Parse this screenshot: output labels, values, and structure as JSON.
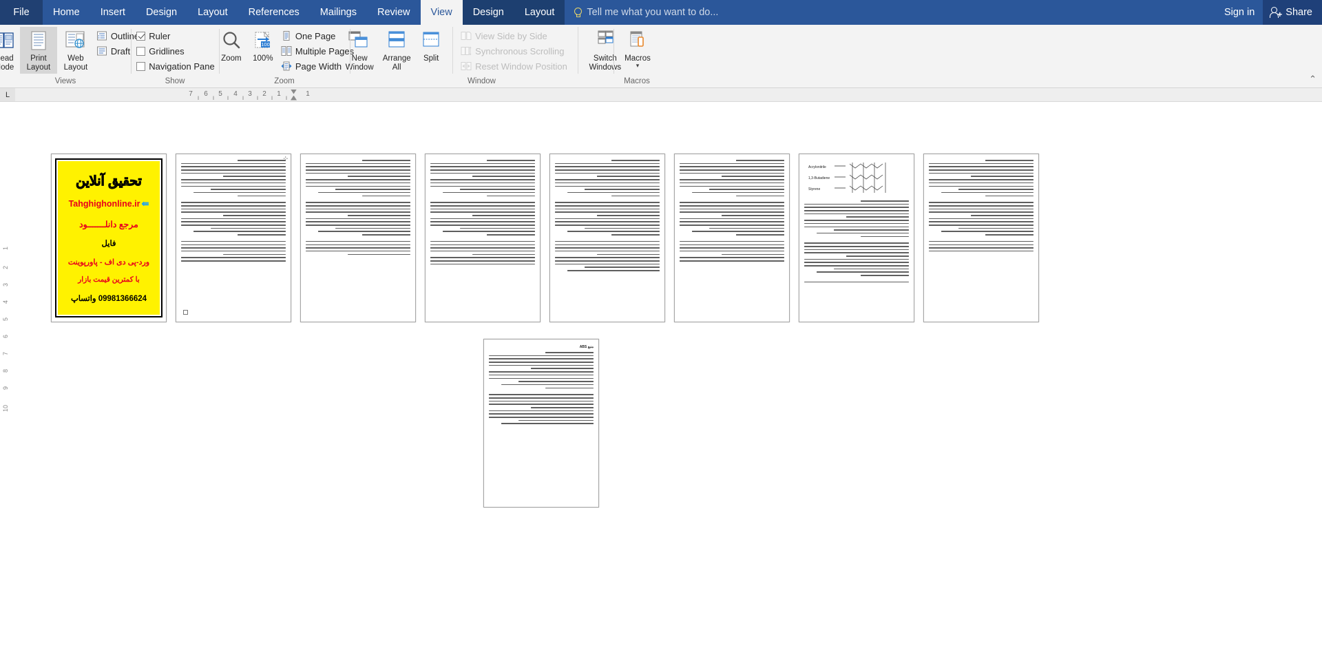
{
  "app": {
    "name": "Microsoft Word",
    "file_tab": "File"
  },
  "tabs": [
    {
      "label": "Home",
      "active": false,
      "contextual": false
    },
    {
      "label": "Insert",
      "active": false,
      "contextual": false
    },
    {
      "label": "Design",
      "active": false,
      "contextual": false
    },
    {
      "label": "Layout",
      "active": false,
      "contextual": false
    },
    {
      "label": "References",
      "active": false,
      "contextual": false
    },
    {
      "label": "Mailings",
      "active": false,
      "contextual": false
    },
    {
      "label": "Review",
      "active": false,
      "contextual": false
    },
    {
      "label": "View",
      "active": true,
      "contextual": false
    },
    {
      "label": "Design",
      "active": false,
      "contextual": true
    },
    {
      "label": "Layout",
      "active": false,
      "contextual": true
    }
  ],
  "tellme": {
    "placeholder": "Tell me what you want to do...",
    "icon": "lightbulb-icon"
  },
  "account": {
    "sign_in": "Sign in",
    "share": "Share",
    "share_icon": "person-add-icon"
  },
  "ribbon": {
    "collapse_icon": "chevron-up-icon",
    "groups": [
      {
        "name": "views",
        "label": "Views",
        "big_buttons": [
          {
            "label": "Read\nMode",
            "icon": "read-mode-icon",
            "selected": false
          },
          {
            "label": "Print\nLayout",
            "icon": "print-layout-icon",
            "selected": true
          },
          {
            "label": "Web\nLayout",
            "icon": "web-layout-icon",
            "selected": false
          }
        ],
        "small_items": [
          {
            "label": "Outline",
            "icon": "outline-icon"
          },
          {
            "label": "Draft",
            "icon": "draft-icon"
          }
        ]
      },
      {
        "name": "show",
        "label": "Show",
        "checkboxes": [
          {
            "label": "Ruler",
            "checked": true
          },
          {
            "label": "Gridlines",
            "checked": false
          },
          {
            "label": "Navigation Pane",
            "checked": false
          }
        ]
      },
      {
        "name": "zoom",
        "label": "Zoom",
        "big_buttons": [
          {
            "label": "Zoom",
            "icon": "magnifier-icon",
            "selected": false
          },
          {
            "label": "100%",
            "icon": "zoom-100-icon",
            "selected": false
          }
        ],
        "small_items": [
          {
            "label": "One Page",
            "icon": "one-page-icon"
          },
          {
            "label": "Multiple Pages",
            "icon": "multiple-pages-icon"
          },
          {
            "label": "Page Width",
            "icon": "page-width-icon"
          }
        ]
      },
      {
        "name": "window",
        "label": "Window",
        "big_buttons": [
          {
            "label": "New\nWindow",
            "icon": "new-window-icon",
            "selected": false
          },
          {
            "label": "Arrange\nAll",
            "icon": "arrange-all-icon",
            "selected": false
          },
          {
            "label": "Split",
            "icon": "split-icon",
            "selected": false
          }
        ],
        "small_items": [
          {
            "label": "View Side by Side",
            "icon": "side-by-side-icon",
            "disabled": true
          },
          {
            "label": "Synchronous Scrolling",
            "icon": "sync-scroll-icon",
            "disabled": true
          },
          {
            "label": "Reset Window Position",
            "icon": "reset-position-icon",
            "disabled": true
          }
        ],
        "big_buttons2": [
          {
            "label": "Switch\nWindows",
            "icon": "switch-windows-icon",
            "dropdown": true
          }
        ]
      },
      {
        "name": "macros",
        "label": "Macros",
        "big_buttons": [
          {
            "label": "Macros",
            "icon": "macros-icon",
            "dropdown": true
          }
        ]
      }
    ]
  },
  "ruler": {
    "tab_selector": "L",
    "numbers": [
      "7",
      "6",
      "5",
      "4",
      "3",
      "2",
      "1",
      "1"
    ],
    "direction": "rtl"
  },
  "vertical_ruler": {
    "numbers": [
      "1",
      "2",
      "3",
      "4",
      "5",
      "6",
      "7",
      "8",
      "9",
      "10"
    ]
  },
  "document": {
    "zoom_level": "100%",
    "view": "Print Layout",
    "language": "Persian",
    "total_pages": 9,
    "pages": [
      {
        "index": 1,
        "type": "advertisement",
        "ad": {
          "heading": "تحقیق آنلاین",
          "website": "Tahghighonline.ir",
          "line_download": "مرجع دانلـــــــود",
          "line_file": "فایل",
          "line_formats": "ورد-پی دی اف - پاورپوینت",
          "line_price": "با کمترین قیمت بازار",
          "phone": "09981366624 واتساپ",
          "bg_color": "#fff200",
          "accent_color": "#e8001c",
          "link_color": "#1da1f2"
        }
      },
      {
        "index": 2,
        "type": "text",
        "lines": 30,
        "has_handle": true
      },
      {
        "index": 3,
        "type": "text",
        "lines": 28
      },
      {
        "index": 4,
        "type": "text",
        "lines": 31
      },
      {
        "index": 5,
        "type": "text",
        "lines": 33
      },
      {
        "index": 6,
        "type": "text",
        "lines": 30
      },
      {
        "index": 7,
        "type": "text",
        "lines": 24,
        "has_figure": true
      },
      {
        "index": 8,
        "type": "text",
        "lines": 27
      },
      {
        "index": 9,
        "type": "text",
        "lines": 22,
        "title": "منبع ABS"
      }
    ]
  },
  "colors": {
    "word_blue": "#2b579a",
    "ribbon_bg": "#f3f3f3",
    "contextual_tab": "#1d3f70",
    "active_tab_bg": "#f3f3f3",
    "share_bg": "#1f4079"
  }
}
